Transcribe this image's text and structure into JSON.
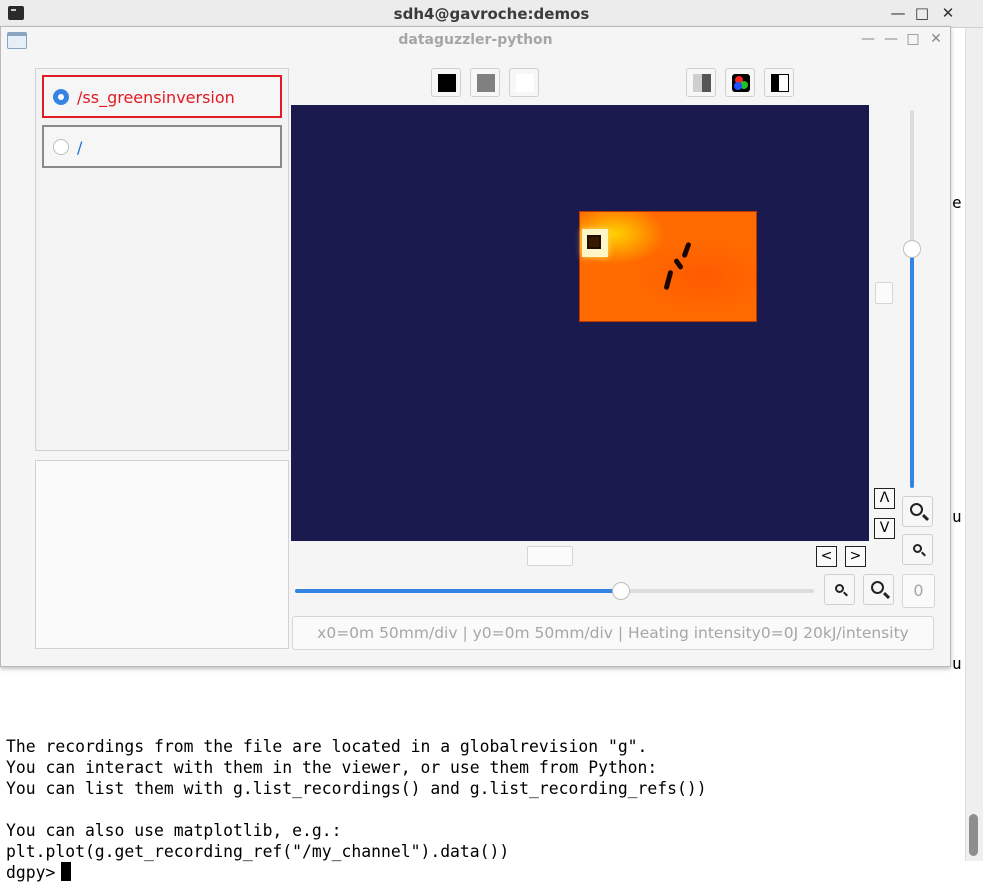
{
  "terminal": {
    "title": "sdh4@gavroche:demos",
    "controls": {
      "minimize": "—",
      "maximize": "□",
      "close": "✕"
    },
    "behind_chars": [
      "e",
      "u",
      "u"
    ],
    "lines": [
      "The recordings from the file are located in a globalrevision \"g\".",
      "You can interact with them in the viewer, or use them from Python:",
      "You can list them with g.list_recordings() and g.list_recording_refs())",
      "",
      "You can also use matplotlib, e.g.:",
      "plt.plot(g.get_recording_ref(\"/my_channel\").data())"
    ],
    "prompt": "dgpy>"
  },
  "app": {
    "title": "dataguzzler-python",
    "controls": {
      "minimize": "—",
      "maximize": "□",
      "close": "✕"
    },
    "recordings": [
      {
        "label": "/ss_greensinversion",
        "selected": true
      },
      {
        "label": "/",
        "selected": false
      }
    ],
    "color_buttons": [
      {
        "name": "black",
        "color": "#000000"
      },
      {
        "name": "gray",
        "color": "#808080"
      },
      {
        "name": "white",
        "color": "#ffffff"
      },
      {
        "name": "gray-gradient",
        "color": "#808080"
      },
      {
        "name": "rgb",
        "color": "#ff0000"
      },
      {
        "name": "black-white",
        "color": "#000000"
      }
    ],
    "nav": {
      "up": "Λ",
      "down": "V",
      "left": "<",
      "right": ">"
    },
    "zero_label": "0",
    "status": "x0=0m 50mm/div | y0=0m 50mm/div | Heating intensity0=0J 20kJ/intensity",
    "colors": {
      "viewer_bg": "#1a1a4e",
      "accent": "#3584e4",
      "selected_border": "#e01b24",
      "heat": "#ff6a00"
    },
    "horizontal_slider_fraction": 0.63,
    "vertical_slider_fraction": 0.63
  }
}
